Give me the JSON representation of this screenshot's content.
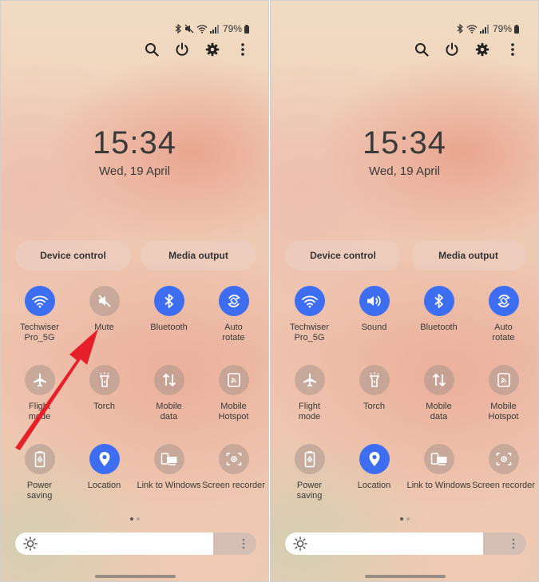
{
  "panels": [
    {
      "status": {
        "battery_pct": "79%"
      },
      "clock": "15:34",
      "date": "Wed, 19 April",
      "pills": [
        "Device control",
        "Media output"
      ],
      "tiles": [
        {
          "label": "Techwiser\nPro_5G",
          "icon": "wifi-icon",
          "active": true
        },
        {
          "label": "Mute",
          "icon": "mute-icon",
          "active": false
        },
        {
          "label": "Bluetooth",
          "icon": "bluetooth-icon",
          "active": true
        },
        {
          "label": "Auto\nrotate",
          "icon": "auto-rotate-icon",
          "active": true
        },
        {
          "label": "Flight\nmode",
          "icon": "airplane-icon",
          "active": false
        },
        {
          "label": "Torch",
          "icon": "torch-icon",
          "active": false
        },
        {
          "label": "Mobile\ndata",
          "icon": "mobile-data-icon",
          "active": false
        },
        {
          "label": "Mobile\nHotspot",
          "icon": "hotspot-icon",
          "active": false
        },
        {
          "label": "Power\nsaving",
          "icon": "power-saving-icon",
          "active": false
        },
        {
          "label": "Location",
          "icon": "location-icon",
          "active": true
        },
        {
          "label": "Link to Windows",
          "icon": "link-to-windows-icon",
          "active": false
        },
        {
          "label": "Screen recorder",
          "icon": "screen-recorder-icon",
          "active": false
        }
      ],
      "brightness": 0.82
    },
    {
      "status": {
        "battery_pct": "79%"
      },
      "clock": "15:34",
      "date": "Wed, 19 April",
      "pills": [
        "Device control",
        "Media output"
      ],
      "tiles": [
        {
          "label": "Techwiser\nPro_5G",
          "icon": "wifi-icon",
          "active": true
        },
        {
          "label": "Sound",
          "icon": "sound-icon",
          "active": true
        },
        {
          "label": "Bluetooth",
          "icon": "bluetooth-icon",
          "active": true
        },
        {
          "label": "Auto\nrotate",
          "icon": "auto-rotate-icon",
          "active": true
        },
        {
          "label": "Flight\nmode",
          "icon": "airplane-icon",
          "active": false
        },
        {
          "label": "Torch",
          "icon": "torch-icon",
          "active": false
        },
        {
          "label": "Mobile\ndata",
          "icon": "mobile-data-icon",
          "active": false
        },
        {
          "label": "Mobile\nHotspot",
          "icon": "hotspot-icon",
          "active": false
        },
        {
          "label": "Power\nsaving",
          "icon": "power-saving-icon",
          "active": false
        },
        {
          "label": "Location",
          "icon": "location-icon",
          "active": true
        },
        {
          "label": "Link to Windows",
          "icon": "link-to-windows-icon",
          "active": false
        },
        {
          "label": "Screen recorder",
          "icon": "screen-recorder-icon",
          "active": false
        }
      ],
      "brightness": 0.82
    }
  ],
  "colors": {
    "accent": "#3d6ef2",
    "annotation_arrow": "#e5202a"
  }
}
